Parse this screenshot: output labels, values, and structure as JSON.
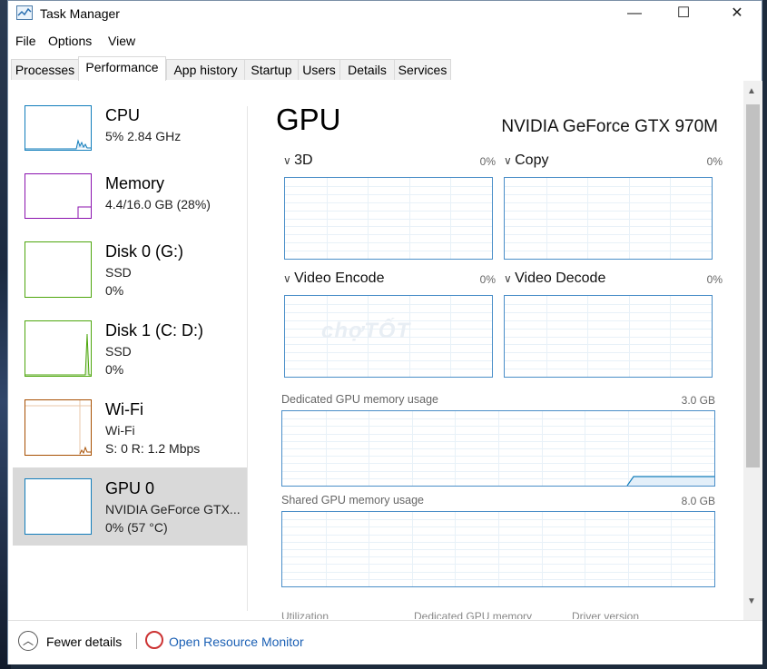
{
  "window": {
    "title": "Task Manager",
    "controls": {
      "minimize": "—",
      "maximize": "☐",
      "close": "✕"
    }
  },
  "menu": [
    "File",
    "Options",
    "View"
  ],
  "tabs": [
    "Processes",
    "Performance",
    "App history",
    "Startup",
    "Users",
    "Details",
    "Services"
  ],
  "active_tab": "Performance",
  "sidebar": [
    {
      "name": "CPU",
      "sub1": "5%  2.84 GHz",
      "sub2": "",
      "color": "#117dbb"
    },
    {
      "name": "Memory",
      "sub1": "4.4/16.0 GB (28%)",
      "sub2": "",
      "color": "#8b12ae"
    },
    {
      "name": "Disk 0 (G:)",
      "sub1": "SSD",
      "sub2": "0%",
      "color": "#4da60c"
    },
    {
      "name": "Disk 1 (C: D:)",
      "sub1": "SSD",
      "sub2": "0%",
      "color": "#4da60c"
    },
    {
      "name": "Wi-Fi",
      "sub1": "Wi-Fi",
      "sub2": "S: 0  R: 1.2 Mbps",
      "color": "#a74f01"
    },
    {
      "name": "GPU 0",
      "sub1": "NVIDIA GeForce GTX...",
      "sub2": "0%  (57 °C)",
      "color": "#117dbb",
      "selected": true
    }
  ],
  "gpu": {
    "title": "GPU",
    "model": "NVIDIA GeForce GTX 970M",
    "engines": [
      {
        "label": "3D",
        "percent": "0%"
      },
      {
        "label": "Copy",
        "percent": "0%"
      },
      {
        "label": "Video Encode",
        "percent": "0%"
      },
      {
        "label": "Video Decode",
        "percent": "0%"
      }
    ],
    "dedicated": {
      "label": "Dedicated GPU memory usage",
      "max": "3.0 GB"
    },
    "shared": {
      "label": "Shared GPU memory usage",
      "max": "8.0 GB"
    },
    "cut_labels": [
      "Utilization",
      "Dedicated GPU memory",
      "Driver version"
    ]
  },
  "footer": {
    "fewer_details": "Fewer details",
    "resource_monitor": "Open Resource Monitor"
  },
  "watermark": "chợTỐT"
}
